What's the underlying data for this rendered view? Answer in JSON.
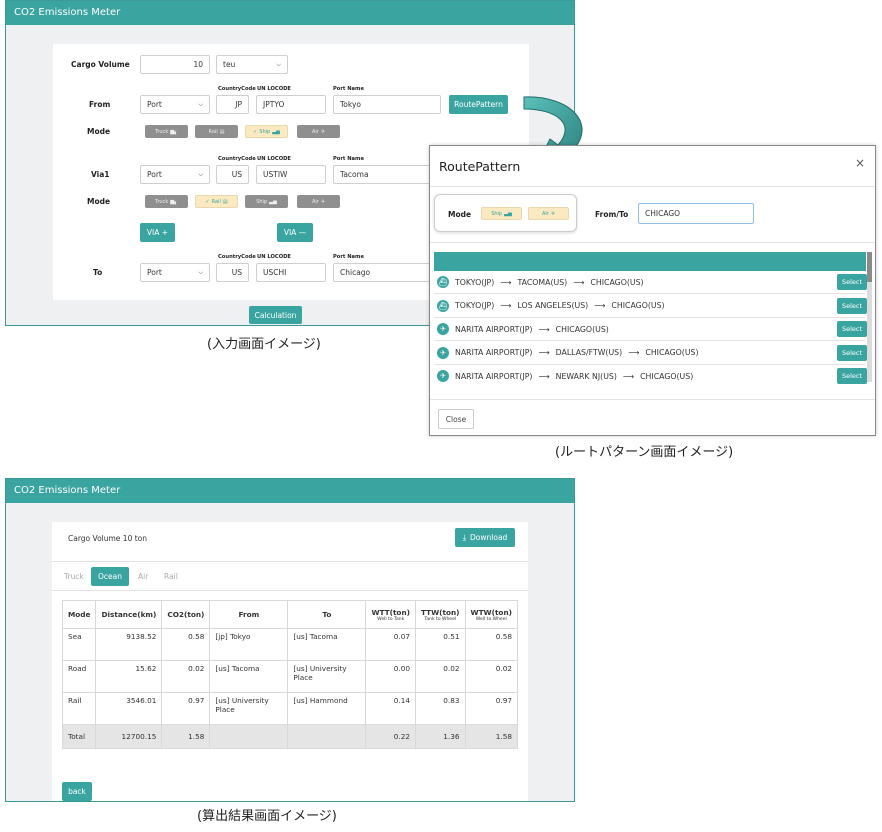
{
  "app_title": "CO2 Emissions Meter",
  "input": {
    "cargo_volume_label": "Cargo Volume",
    "cargo_volume_value": "10",
    "cargo_unit": "teu",
    "country_code_header": "CountryCode",
    "unlocode_header": "UN LOCODE",
    "port_name_header": "Port Name",
    "from_label": "From",
    "from_type": "Port",
    "from_country": "JP",
    "from_locode": "JPTYO",
    "from_port": "Tokyo",
    "route_pattern_button": "RoutePattern",
    "mode_label": "Mode",
    "mode_chips": [
      "Truck",
      "Rail",
      "Ship",
      "Air"
    ],
    "via_label": "Via1",
    "via_type": "Port",
    "via_country": "US",
    "via_locode": "USTIW",
    "via_port": "Tacoma",
    "via_plus": "VIA +",
    "via_minus": "VIA —",
    "to_label": "To",
    "to_type": "Port",
    "to_country": "US",
    "to_locode": "USCHI",
    "to_port": "Chicago",
    "calculation_button": "Calculation",
    "caption": "(入力画面イメージ)"
  },
  "route_modal": {
    "title": "RoutePattern",
    "close_x": "×",
    "mode_label": "Mode",
    "mode_chips": [
      "Ship",
      "Air"
    ],
    "from_to_label": "From/To",
    "from_to_value": "CHICAGO",
    "select_label": "Select",
    "routes": [
      [
        "TOKYO(JP)",
        "TACOMA(US)",
        "CHICAGO(US)"
      ],
      [
        "TOKYO(JP)",
        "LOS ANGELES(US)",
        "CHICAGO(US)"
      ],
      [
        "NARITA AIRPORT(JP)",
        "CHICAGO(US)"
      ],
      [
        "NARITA AIRPORT(JP)",
        "DALLAS/FTW(US)",
        "CHICAGO(US)"
      ],
      [
        "NARITA AIRPORT(JP)",
        "NEWARK NJ(US)",
        "CHICAGO(US)"
      ]
    ],
    "close_button": "Close",
    "caption": "(ルートパターン画面イメージ)"
  },
  "result": {
    "cargo_summary": "Cargo Volume 10 ton",
    "download_button": "Download",
    "tabs": [
      "Truck",
      "Ocean",
      "Air",
      "Rail"
    ],
    "active_tab": "Ocean",
    "columns": [
      {
        "label": "Mode",
        "sub": ""
      },
      {
        "label": "Distance(km)",
        "sub": ""
      },
      {
        "label": "CO2(ton)",
        "sub": ""
      },
      {
        "label": "From",
        "sub": ""
      },
      {
        "label": "To",
        "sub": ""
      },
      {
        "label": "WTT(ton)",
        "sub": "Well to Tank"
      },
      {
        "label": "TTW(ton)",
        "sub": "Tank to Wheel"
      },
      {
        "label": "WTW(ton)",
        "sub": "Well to Wheel"
      }
    ],
    "rows": [
      [
        "Sea",
        "9138.52",
        "0.58",
        "[jp] Tokyo",
        "[us] Tacoma",
        "0.07",
        "0.51",
        "0.58"
      ],
      [
        "Road",
        "15.62",
        "0.02",
        "[us] Tacoma",
        "[us] University Place",
        "0.00",
        "0.02",
        "0.02"
      ],
      [
        "Rail",
        "3546.01",
        "0.97",
        "[us] University Place",
        "[us] Hammond",
        "0.14",
        "0.83",
        "0.97"
      ]
    ],
    "total": [
      "Total",
      "12700.15",
      "1.58",
      "",
      "",
      "0.22",
      "1.36",
      "1.58"
    ],
    "back_button": "back",
    "caption": "(算出結果画面イメージ)"
  },
  "colors": {
    "accent": "#3aa5a0",
    "chip_active": "#fbe9c1",
    "chip_inactive": "#8f8f8f"
  }
}
